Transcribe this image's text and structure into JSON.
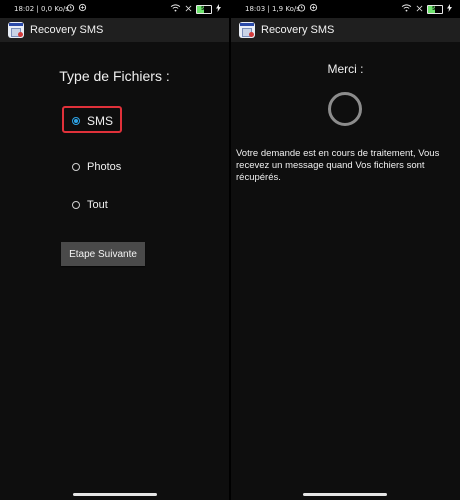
{
  "left_screen": {
    "status_bar": {
      "time": "18:02 | 0,0 Ko/s",
      "battery": "50"
    },
    "app_bar": {
      "title": "Recovery SMS"
    },
    "heading": "Type de Fichiers :",
    "options": [
      {
        "label": "SMS",
        "checked": true
      },
      {
        "label": "Photos",
        "checked": false
      },
      {
        "label": "Tout",
        "checked": false
      }
    ],
    "next_button": "Etape Suivante"
  },
  "right_screen": {
    "status_bar": {
      "time": "18:03 | 1,9 Ko/s",
      "battery": "50"
    },
    "app_bar": {
      "title": "Recovery SMS"
    },
    "heading": "Merci :",
    "message": "Votre demande est en cours de traitement, Vous recevez un message quand Vos fichiers sont récupérés."
  },
  "colors": {
    "accent": "#2ea3e6",
    "highlight": "#e0313a",
    "app_bar": "#1f1f1f",
    "background": "#0e0e0e",
    "battery": "#6fe36f"
  },
  "icons": {
    "status": [
      "alarm-icon",
      "wifi-icon",
      "battery-icon",
      "charging-icon"
    ],
    "app": "recovery-sms-app-icon",
    "loading": "loading-spinner-icon"
  }
}
